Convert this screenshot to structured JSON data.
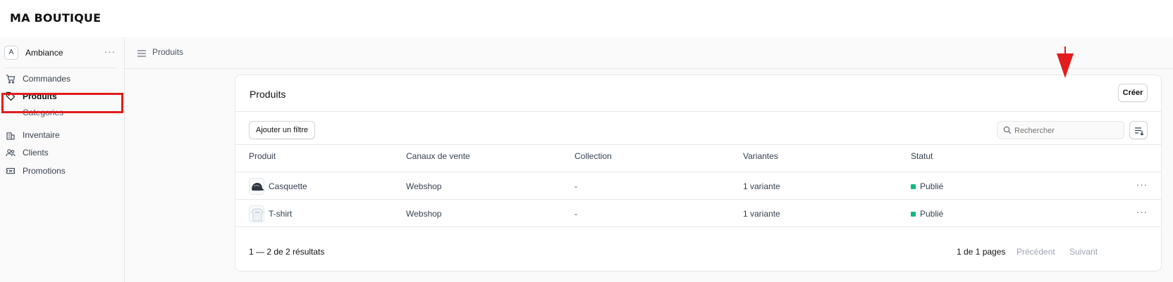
{
  "app": {
    "brand": "MA BOUTIQUE"
  },
  "sidebar": {
    "store": {
      "avatar": "A",
      "name": "Ambiance",
      "more": "···"
    },
    "items": [
      {
        "label": "Commandes",
        "icon": "cart-icon"
      },
      {
        "label": "Produits",
        "icon": "tag-icon",
        "active": true
      },
      {
        "label": "Categories",
        "sub": true
      },
      {
        "label": "Inventaire",
        "icon": "building-icon"
      },
      {
        "label": "Clients",
        "icon": "users-icon"
      },
      {
        "label": "Promotions",
        "icon": "ticket-icon"
      }
    ]
  },
  "header": {
    "breadcrumb": "Produits"
  },
  "card": {
    "title": "Produits",
    "create_label": "Créer",
    "filter_label": "Ajouter un filtre",
    "search_placeholder": "Rechercher"
  },
  "table": {
    "columns": [
      "Produit",
      "Canaux de vente",
      "Collection",
      "Variantes",
      "Statut"
    ],
    "rows": [
      {
        "name": "Casquette",
        "channel": "Webshop",
        "collection": "-",
        "variants": "1 variante",
        "status": "Publié",
        "more": "···"
      },
      {
        "name": "T-shirt",
        "channel": "Webshop",
        "collection": "-",
        "variants": "1 variante",
        "status": "Publié",
        "more": "···"
      }
    ]
  },
  "footer": {
    "count": "1 — 2 de 2 résultats",
    "pages": "1 de 1 pages",
    "prev": "Précédent",
    "next": "Suivant"
  },
  "colors": {
    "status_published": "#10b981",
    "highlight": "#e11d1d",
    "annotation_arrow": "#e11d1d"
  }
}
